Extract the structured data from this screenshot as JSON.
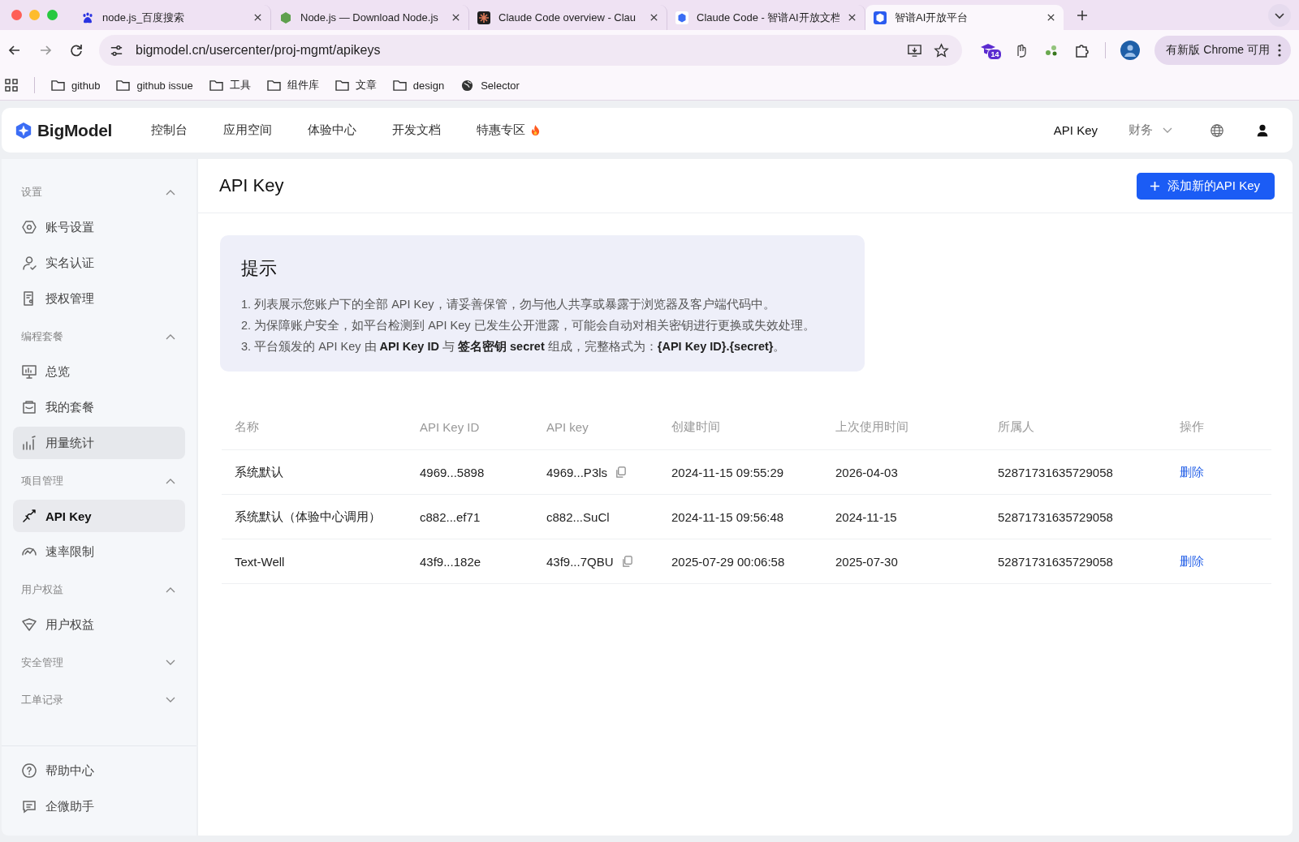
{
  "browser": {
    "tabs": [
      {
        "title": "node.js_百度搜索",
        "selected": false
      },
      {
        "title": "Node.js — Download Node.js",
        "selected": false
      },
      {
        "title": "Claude Code overview - Clau",
        "selected": false
      },
      {
        "title": "Claude Code - 智谱AI开放文档",
        "selected": false
      },
      {
        "title": "智谱AI开放平台",
        "selected": true
      }
    ],
    "url": "bigmodel.cn/usercenter/proj-mgmt/apikeys",
    "extension_badge": "14",
    "update_button": "有新版 Chrome 可用",
    "bookmarks": [
      {
        "label": "github",
        "kind": "folder"
      },
      {
        "label": "github issue",
        "kind": "folder"
      },
      {
        "label": "工具",
        "kind": "folder"
      },
      {
        "label": "组件库",
        "kind": "folder"
      },
      {
        "label": "文章",
        "kind": "folder"
      },
      {
        "label": "design",
        "kind": "folder"
      },
      {
        "label": "Selector",
        "kind": "site"
      }
    ]
  },
  "header": {
    "brand": "BigModel",
    "nav": [
      {
        "label": "控制台",
        "hot": false
      },
      {
        "label": "应用空间",
        "hot": false
      },
      {
        "label": "体验中心",
        "hot": false
      },
      {
        "label": "开发文档",
        "hot": false
      },
      {
        "label": "特惠专区",
        "hot": true
      }
    ],
    "api_key_link": "API Key",
    "finance_menu": "财务"
  },
  "sidebar": {
    "sections": [
      {
        "title": "设置",
        "expanded": true,
        "items": [
          {
            "label": "账号设置",
            "selected": false,
            "hovered": false
          },
          {
            "label": "实名认证",
            "selected": false,
            "hovered": false
          },
          {
            "label": "授权管理",
            "selected": false,
            "hovered": false
          }
        ]
      },
      {
        "title": "编程套餐",
        "expanded": true,
        "items": [
          {
            "label": "总览",
            "selected": false,
            "hovered": false
          },
          {
            "label": "我的套餐",
            "selected": false,
            "hovered": false
          },
          {
            "label": "用量统计",
            "selected": false,
            "hovered": true
          }
        ]
      },
      {
        "title": "项目管理",
        "expanded": true,
        "items": [
          {
            "label": "API Key",
            "selected": true,
            "hovered": false
          },
          {
            "label": "速率限制",
            "selected": false,
            "hovered": false
          }
        ]
      },
      {
        "title": "用户权益",
        "expanded": true,
        "items": [
          {
            "label": "用户权益",
            "selected": false,
            "hovered": false
          }
        ]
      },
      {
        "title": "安全管理",
        "expanded": false
      },
      {
        "title": "工单记录",
        "expanded": false
      }
    ],
    "footer": [
      {
        "label": "帮助中心"
      },
      {
        "label": "企微助手"
      }
    ]
  },
  "page": {
    "title": "API Key",
    "add_button": "添加新的API Key",
    "notice": {
      "title": "提示",
      "lines": [
        "1. 列表展示您账户下的全部 API Key，请妥善保管，勿与他人共享或暴露于浏览器及客户端代码中。",
        "2. 为保障账户安全，如平台检测到 API Key 已发生公开泄露，可能会自动对相关密钥进行更换或失效处理。",
        "3. 平台颁发的 API Key 由 **API Key ID** 与 **签名密钥 secret** 组成，完整格式为：**{API Key ID}.{secret}**。"
      ]
    },
    "table": {
      "columns": [
        "名称",
        "API Key ID",
        "API key",
        "创建时间",
        "上次使用时间",
        "所属人",
        "操作"
      ],
      "rows": [
        {
          "name": "系统默认",
          "key_id": "4969...5898",
          "api_key": "4969...P3ls",
          "copyable": true,
          "created": "2024-11-15 09:55:29",
          "last_used": "2026-04-03",
          "owner": "52871731635729058",
          "action": "删除"
        },
        {
          "name": "系统默认（体验中心调用）",
          "key_id": "c882...ef71",
          "api_key": "c882...SuCl",
          "copyable": false,
          "created": "2024-11-15 09:56:48",
          "last_used": "2024-11-15",
          "owner": "52871731635729058"
        },
        {
          "name": "Text-Well",
          "key_id": "43f9...182e",
          "api_key": "43f9...7QBU",
          "copyable": true,
          "created": "2025-07-29 00:06:58",
          "last_used": "2025-07-30",
          "owner": "52871731635729058",
          "action": "删除"
        }
      ]
    }
  }
}
